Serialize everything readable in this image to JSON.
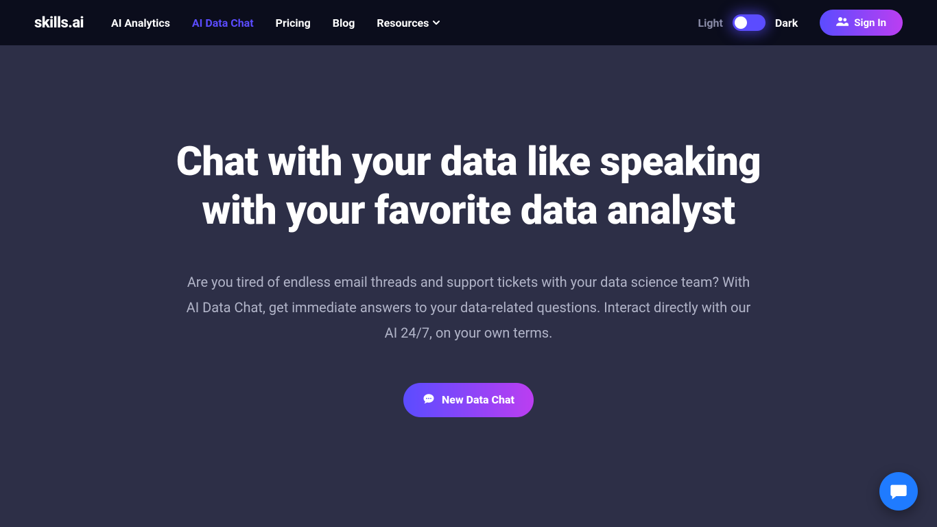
{
  "header": {
    "logo": "skills.ai",
    "nav": [
      {
        "label": "AI Analytics",
        "active": false
      },
      {
        "label": "AI Data Chat",
        "active": true
      },
      {
        "label": "Pricing",
        "active": false
      },
      {
        "label": "Blog",
        "active": false
      },
      {
        "label": "Resources",
        "active": false,
        "dropdown": true
      }
    ],
    "theme": {
      "light_label": "Light",
      "dark_label": "Dark",
      "value": "dark"
    },
    "signin_label": "Sign In"
  },
  "hero": {
    "title": "Chat with your data like speaking with your favorite data analyst",
    "subtitle": "Are you tired of endless email threads and support tickets with your data science team? With AI Data Chat, get immediate answers to your data-related questions. Interact directly with our AI 24/7, on your own terms.",
    "cta_label": "New Data Chat"
  },
  "colors": {
    "header_bg": "#0b0d1c",
    "page_bg": "#2d2f47",
    "accent_primary": "#5b4cff",
    "accent_secondary": "#bb3ef1",
    "fab_bg": "#1f7bff",
    "muted_text": "#b2b5c9"
  }
}
